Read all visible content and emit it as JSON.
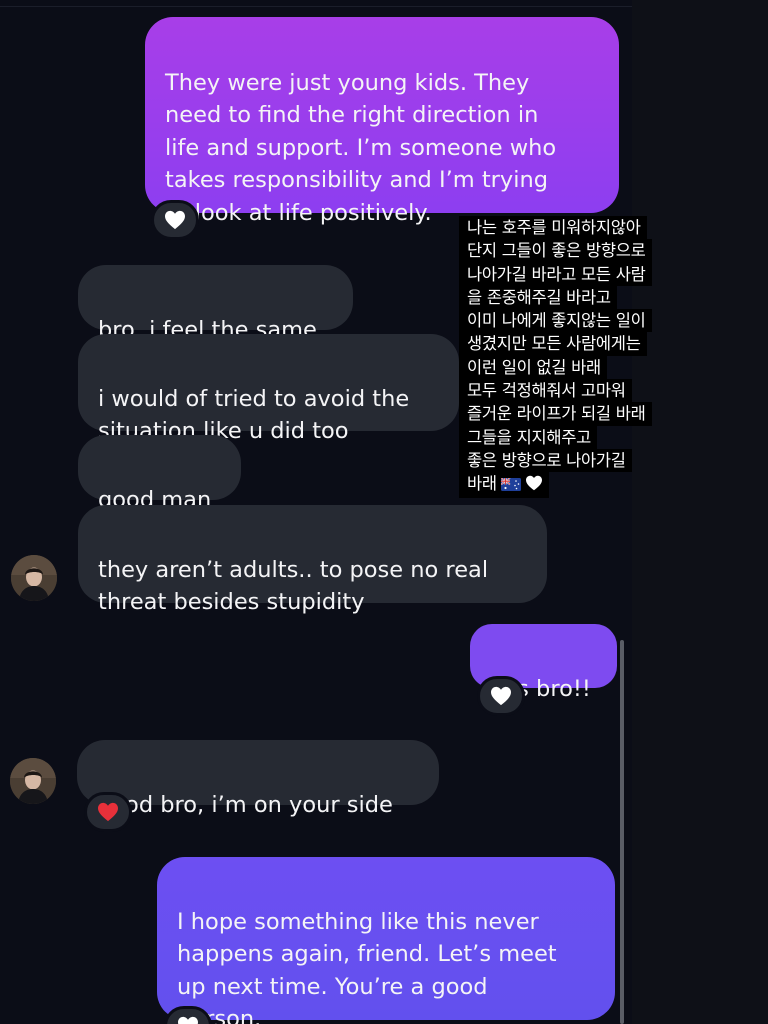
{
  "conversation": {
    "messages": [
      {
        "id": "m1",
        "direction": "outgoing",
        "text": "They were just young kids. They\nneed to find the right direction in\nlife and support. I’m someone who\ntakes responsibility and I’m trying\nto look at life positively.",
        "reaction": "white-heart-icon"
      },
      {
        "id": "m2",
        "direction": "incoming",
        "text": "bro, i feel the same"
      },
      {
        "id": "m3",
        "direction": "incoming",
        "text": "i would of tried to avoid the\nsituation like u did too"
      },
      {
        "id": "m4",
        "direction": "incoming",
        "text": "good man"
      },
      {
        "id": "m5",
        "direction": "incoming",
        "text": "they aren’t adults.. to pose no real\nthreat besides stupidity"
      },
      {
        "id": "m6",
        "direction": "outgoing",
        "text": "yes bro!!",
        "reaction": "white-heart-icon"
      },
      {
        "id": "m7",
        "direction": "incoming",
        "text": "good bro, i’m on your side",
        "reaction": "red-heart-icon"
      },
      {
        "id": "m8",
        "direction": "outgoing",
        "text": "I hope something like this never\nhappens again, friend. Let’s meet\nup next time. You’re a good\nperson.",
        "reaction": "white-heart-icon"
      }
    ]
  },
  "caption": {
    "lines": [
      "나는 호주를 미워하지않아",
      "단지 그들이 좋은 방향으로",
      "나아가길 바라고 모든 사람",
      "을 존중해주길 바라고",
      "이미 나에게 좋지않는 일이",
      "생겼지만 모든 사람에게는",
      "이런 일이 없길 바래",
      "모두 걱정해줘서 고마워",
      "즐거운 라이프가 되길 바래",
      "그들을 지지해주고",
      "좋은 방향으로 나아가길",
      "바래"
    ],
    "trailing_icons": [
      "australia-flag-icon",
      "white-heart-icon"
    ]
  },
  "colors": {
    "background": "#0b0d17",
    "incoming_bubble": "#262a33",
    "outgoing_purple": "#9a3ef0",
    "outgoing_violet": "#6d4ff2",
    "white_heart": "#ffffff",
    "red_heart": "#e8303a"
  }
}
